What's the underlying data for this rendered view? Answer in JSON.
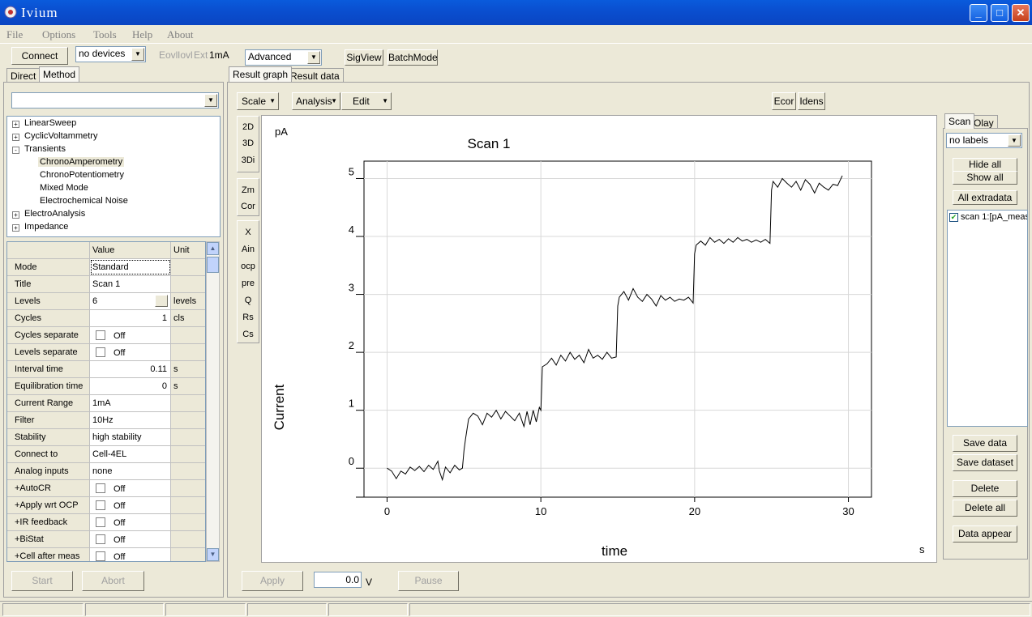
{
  "window": {
    "title": "Ivium"
  },
  "menu": [
    "File",
    "Options",
    "Tools",
    "Help",
    "About"
  ],
  "toolbar": {
    "connect": "Connect",
    "device": "no devices",
    "eovl": "Eovl",
    "iovl": "Iovl",
    "ext": "Ext",
    "range": "1mA",
    "mode": "Advanced",
    "sigview": "SigView",
    "batchmode": "BatchMode"
  },
  "left_tabs": [
    "Direct",
    "Method"
  ],
  "method_combo": "",
  "tree": [
    {
      "label": "LinearSweep",
      "level": 0,
      "pm": "+"
    },
    {
      "label": "CyclicVoltammetry",
      "level": 0,
      "pm": "+"
    },
    {
      "label": "Transients",
      "level": 0,
      "pm": "-"
    },
    {
      "label": "ChronoAmperometry",
      "level": 1,
      "pm": ""
    },
    {
      "label": "ChronoPotentiometry",
      "level": 1,
      "pm": ""
    },
    {
      "label": "Mixed Mode",
      "level": 1,
      "pm": ""
    },
    {
      "label": "Electrochemical Noise",
      "level": 1,
      "pm": ""
    },
    {
      "label": "ElectroAnalysis",
      "level": 0,
      "pm": "+"
    },
    {
      "label": "Impedance",
      "level": 0,
      "pm": "+"
    }
  ],
  "params": {
    "headers": [
      "",
      "Value",
      "Unit"
    ],
    "rows": [
      {
        "name": "Mode",
        "value": "Standard",
        "unit": ""
      },
      {
        "name": "Title",
        "value": "Scan 1",
        "unit": ""
      },
      {
        "name": "Levels",
        "value": "6",
        "unit": "levels"
      },
      {
        "name": "Cycles",
        "value": "1",
        "unit": "cls"
      },
      {
        "name": "Cycles separate",
        "value": "Off",
        "unit": ""
      },
      {
        "name": "Levels separate",
        "value": "Off",
        "unit": ""
      },
      {
        "name": "Interval time",
        "value": "0.11",
        "unit": "s"
      },
      {
        "name": "Equilibration time",
        "value": "0",
        "unit": "s"
      },
      {
        "name": "Current Range",
        "value": "1mA",
        "unit": ""
      },
      {
        "name": "Filter",
        "value": "10Hz",
        "unit": ""
      },
      {
        "name": "Stability",
        "value": "high stability",
        "unit": ""
      },
      {
        "name": "Connect to",
        "value": "Cell-4EL",
        "unit": ""
      },
      {
        "name": "Analog inputs",
        "value": "none",
        "unit": ""
      },
      {
        "name": "+AutoCR",
        "value": "Off",
        "unit": ""
      },
      {
        "name": "+Apply wrt OCP",
        "value": "Off",
        "unit": ""
      },
      {
        "name": "+IR feedback",
        "value": "Off",
        "unit": ""
      },
      {
        "name": "+BiStat",
        "value": "Off",
        "unit": ""
      },
      {
        "name": "+Cell after meas",
        "value": "Off",
        "unit": ""
      }
    ]
  },
  "left_buttons": {
    "start": "Start",
    "abort": "Abort"
  },
  "result_tabs": [
    "Result graph",
    "Result data"
  ],
  "graph_toolbar": {
    "scale": "Scale",
    "analysis": "Analysis",
    "edit": "Edit",
    "ecor": "Ecor",
    "idens": "Idens"
  },
  "side_tools": {
    "group1": [
      "2D",
      "3D",
      "3Di"
    ],
    "group2": [
      "Zm",
      "Cor"
    ],
    "group3": [
      "X",
      "Ain",
      "ocp",
      "pre",
      "Q",
      "Rs",
      "Cs"
    ]
  },
  "right_panel": {
    "tabs": [
      "Scan",
      "Olay"
    ],
    "labels_combo": "no labels",
    "hide_all": "Hide all",
    "show_all": "Show all",
    "all_extradata": "All extradata",
    "scan_item": "scan 1:[pA_meas",
    "save_data": "Save data",
    "save_dataset": "Save dataset",
    "delete": "Delete",
    "delete_all": "Delete all",
    "data_appear": "Data appear"
  },
  "bottom": {
    "apply": "Apply",
    "voltage": "0.0",
    "volt_unit": "V",
    "pause": "Pause"
  },
  "chart_data": {
    "type": "line",
    "title": "Scan 1",
    "xlabel": "time",
    "ylabel": "Current",
    "x_unit": "s",
    "y_unit": "pA",
    "xlim": [
      -1.5,
      31.5
    ],
    "ylim": [
      -0.5,
      5.3
    ],
    "xticks": [
      0,
      10,
      20,
      30
    ],
    "yticks": [
      0,
      1,
      2,
      3,
      4,
      5
    ],
    "grid": true,
    "series": [
      {
        "x": [
          0,
          0.3,
          0.6,
          0.9,
          1.2,
          1.5,
          1.8,
          2.1,
          2.4,
          2.7,
          3.0,
          3.3,
          3.4,
          3.6,
          3.8,
          4.1,
          4.4,
          4.7,
          4.9,
          5.0,
          5.1,
          5.3,
          5.6,
          5.9,
          6.2,
          6.5,
          6.8,
          7.1,
          7.4,
          7.7,
          8.0,
          8.3,
          8.6,
          8.9,
          9.1,
          9.3,
          9.5,
          9.7,
          9.9,
          10.0,
          10.1,
          10.4,
          10.7,
          11.0,
          11.3,
          11.6,
          11.9,
          12.2,
          12.5,
          12.8,
          13.1,
          13.4,
          13.7,
          14.0,
          14.3,
          14.6,
          14.9,
          15.0,
          15.1,
          15.4,
          15.7,
          16.0,
          16.3,
          16.6,
          16.9,
          17.2,
          17.5,
          17.8,
          18.1,
          18.4,
          18.7,
          19.0,
          19.3,
          19.6,
          19.9,
          20.0,
          20.1,
          20.4,
          20.7,
          21.0,
          21.3,
          21.6,
          21.9,
          22.2,
          22.5,
          22.8,
          23.1,
          23.4,
          23.7,
          24.0,
          24.3,
          24.6,
          24.9,
          25.0,
          25.1,
          25.4,
          25.7,
          26.0,
          26.3,
          26.6,
          26.9,
          27.2,
          27.5,
          27.8,
          28.1,
          28.4,
          28.7,
          29.0,
          29.3,
          29.6
        ],
        "y": [
          0.0,
          -0.05,
          -0.18,
          -0.05,
          -0.1,
          0.02,
          -0.04,
          0.03,
          -0.06,
          0.05,
          -0.02,
          0.12,
          -0.05,
          -0.2,
          0.02,
          -0.08,
          0.05,
          -0.03,
          0.0,
          0.3,
          0.5,
          0.85,
          0.95,
          0.9,
          0.75,
          0.95,
          0.88,
          1.0,
          0.85,
          0.98,
          0.9,
          0.82,
          0.95,
          0.72,
          0.98,
          0.75,
          1.0,
          0.8,
          1.05,
          1.0,
          1.75,
          1.8,
          1.9,
          1.78,
          1.95,
          1.85,
          2.0,
          1.88,
          1.95,
          1.82,
          2.05,
          1.9,
          1.95,
          1.88,
          2.0,
          1.9,
          1.92,
          2.8,
          2.95,
          3.05,
          2.9,
          3.1,
          2.95,
          2.88,
          3.0,
          2.92,
          2.8,
          2.98,
          2.9,
          2.95,
          2.88,
          2.92,
          2.9,
          2.95,
          2.85,
          3.7,
          3.85,
          3.92,
          3.85,
          3.98,
          3.9,
          3.95,
          3.88,
          3.96,
          3.9,
          3.98,
          3.92,
          3.95,
          3.9,
          3.94,
          3.9,
          3.95,
          3.88,
          4.8,
          4.95,
          4.85,
          5.0,
          4.92,
          4.85,
          4.95,
          4.8,
          4.98,
          4.9,
          4.75,
          4.92,
          4.85,
          4.8,
          4.9,
          4.88,
          5.05
        ]
      }
    ]
  }
}
